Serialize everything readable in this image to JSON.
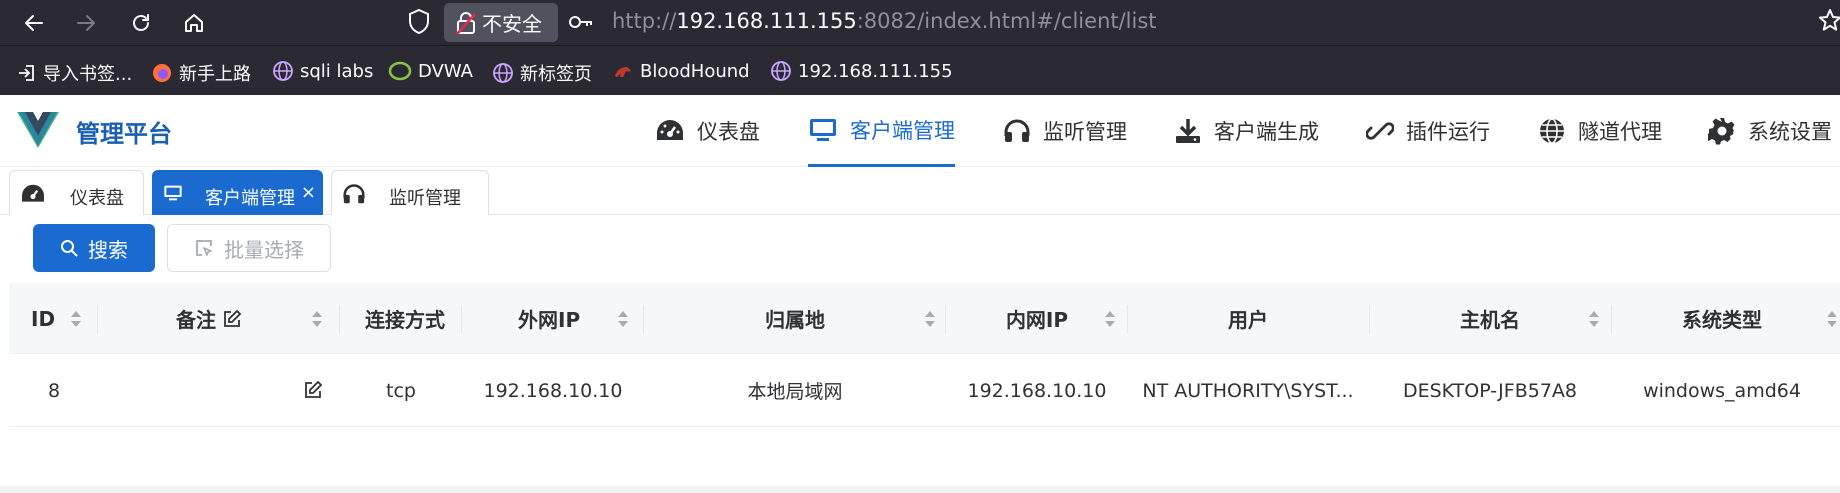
{
  "browser": {
    "security_label": "不安全",
    "url_prefix": "http://",
    "url_host": "192.168.111.155",
    "url_rest": ":8082/index.html#/client/list",
    "bookmarks": [
      {
        "label": "导入书签...",
        "icon": "import-icon"
      },
      {
        "label": "新手上路",
        "icon": "firefox-icon"
      },
      {
        "label": "sqli labs",
        "icon": "globe-icon"
      },
      {
        "label": "DVWA",
        "icon": "dvwa-icon"
      },
      {
        "label": "新标签页",
        "icon": "globe-icon"
      },
      {
        "label": "BloodHound",
        "icon": "bloodhound-icon"
      },
      {
        "label": "192.168.111.155",
        "icon": "globe-icon"
      }
    ]
  },
  "header": {
    "brand": "管理平台",
    "menu": [
      {
        "label": "仪表盘",
        "icon": "dashboard-icon"
      },
      {
        "label": "客户端管理",
        "icon": "monitor-icon",
        "active": true
      },
      {
        "label": "监听管理",
        "icon": "headphones-icon"
      },
      {
        "label": "客户端生成",
        "icon": "download-icon"
      },
      {
        "label": "插件运行",
        "icon": "plugin-icon"
      },
      {
        "label": "隧道代理",
        "icon": "globe-icon"
      },
      {
        "label": "系统设置",
        "icon": "gear-icon"
      }
    ]
  },
  "tabs": [
    {
      "label": "仪表盘",
      "icon": "dashboard-icon"
    },
    {
      "label": "客户端管理",
      "icon": "monitor-icon",
      "active": true,
      "close": "×"
    },
    {
      "label": "监听管理",
      "icon": "headphones-icon"
    }
  ],
  "toolbar": {
    "search_label": "搜索",
    "batch_label": "批量选择"
  },
  "table": {
    "columns": [
      "ID",
      "备注",
      "连接方式",
      "外网IP",
      "归属地",
      "内网IP",
      "用户",
      "主机名",
      "系统类型"
    ],
    "rows": [
      {
        "id": "8",
        "note": "",
        "conn": "tcp",
        "public_ip": "192.168.10.10",
        "location": "本地局域网",
        "private_ip": "192.168.10.10",
        "user": "NT AUTHORITY\\SYST...",
        "hostname": "DESKTOP-JFB57A8",
        "os": "windows_amd64"
      }
    ]
  },
  "colors": {
    "primary": "#1a6ad0",
    "brand": "#1b5fb0",
    "browser_chrome": "#2b2a33"
  }
}
